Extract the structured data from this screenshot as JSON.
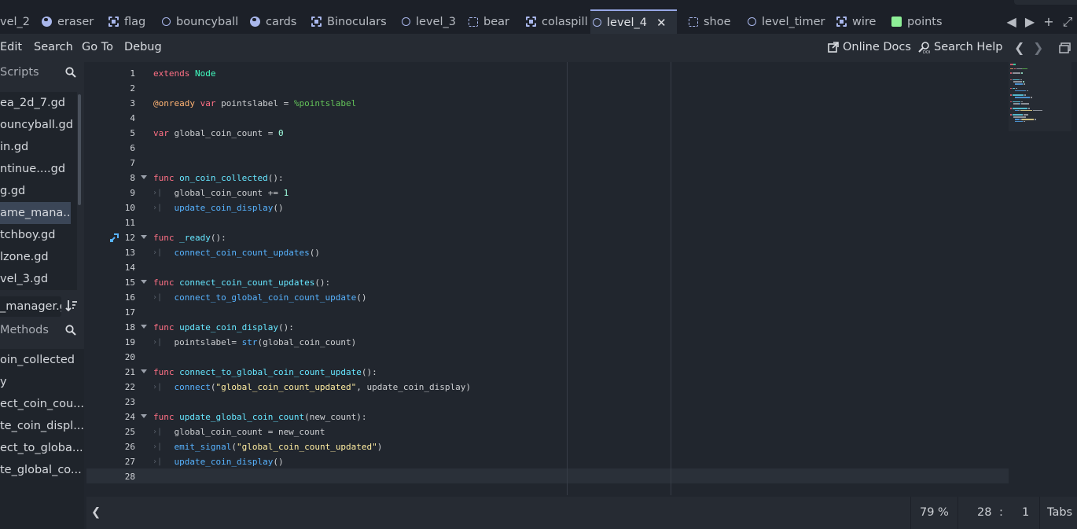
{
  "tabs": [
    {
      "label": "vel_2",
      "icon": "scene-icon"
    },
    {
      "label": "eraser",
      "icon": "globe-icon"
    },
    {
      "label": "flag",
      "icon": "frame-icon"
    },
    {
      "label": "bouncyball",
      "icon": "scene-icon"
    },
    {
      "label": "cards",
      "icon": "globe-icon"
    },
    {
      "label": "Binoculars",
      "icon": "frame-icon"
    },
    {
      "label": "level_3",
      "icon": "scene-icon"
    },
    {
      "label": "bear",
      "icon": "rect-icon"
    },
    {
      "label": "colaspill",
      "icon": "frame-icon"
    },
    {
      "label": "level_4",
      "icon": "scene-icon",
      "active": true,
      "close": "✕"
    },
    {
      "label": "shoe",
      "icon": "rect-icon"
    },
    {
      "label": "level_timer",
      "icon": "scene-icon"
    },
    {
      "label": "wire",
      "icon": "frame-icon"
    },
    {
      "label": "points",
      "icon": "green-icon"
    }
  ],
  "tab_tools": {
    "prev": "◀",
    "next": "▶",
    "add": "+",
    "distraction": "⤢"
  },
  "menu": {
    "edit": "Edit",
    "search": "Search",
    "goto": "Go To",
    "debug": "Debug",
    "online_docs": "Online Docs",
    "search_help": "Search Help",
    "back": "❮",
    "forward": "❯"
  },
  "scripts_panel": {
    "title": "Scripts",
    "items": [
      "ea_2d_7.gd",
      "ouncyball.gd",
      "in.gd",
      "ntinue....gd",
      "g.gd",
      "ame_mana...",
      "tchboy.gd",
      "lzone.gd",
      "vel_3.gd"
    ],
    "selected_index": 5,
    "filter_value": "_manager.g"
  },
  "methods_panel": {
    "title": "Methods",
    "items": [
      "oin_collected",
      "y",
      "ect_coin_cou...",
      "te_coin_displ...",
      "ect_to_globa...",
      "te_global_co..."
    ]
  },
  "code_lines": [
    {
      "n": "1",
      "tokens": [
        [
          "kw",
          "extends "
        ],
        [
          "ty",
          "Node"
        ]
      ]
    },
    {
      "n": "2",
      "tokens": []
    },
    {
      "n": "3",
      "tokens": [
        [
          "an",
          "@onready "
        ],
        [
          "kw",
          "var "
        ],
        [
          "tx",
          "pointslabel = "
        ],
        [
          "np",
          "%pointslabel"
        ]
      ]
    },
    {
      "n": "4",
      "tokens": []
    },
    {
      "n": "5",
      "tokens": [
        [
          "kw",
          "var "
        ],
        [
          "tx",
          "global_coin_count = "
        ],
        [
          "nm",
          "0"
        ]
      ]
    },
    {
      "n": "6",
      "tokens": []
    },
    {
      "n": "7",
      "tokens": []
    },
    {
      "n": "8",
      "fold": true,
      "tokens": [
        [
          "kw",
          "func "
        ],
        [
          "dfn",
          "on_coin_collected"
        ],
        [
          "tx",
          "():"
        ]
      ]
    },
    {
      "n": "9",
      "tab": true,
      "tokens": [
        [
          "tx",
          "    global_coin_count += "
        ],
        [
          "nm",
          "1"
        ]
      ]
    },
    {
      "n": "10",
      "tab": true,
      "tokens": [
        [
          "tx",
          "    "
        ],
        [
          "fn",
          "update_coin_display"
        ],
        [
          "tx",
          "()"
        ]
      ]
    },
    {
      "n": "11",
      "tokens": []
    },
    {
      "n": "12",
      "fold": true,
      "icon": true,
      "tokens": [
        [
          "kw",
          "func "
        ],
        [
          "dfn",
          "_ready"
        ],
        [
          "tx",
          "():"
        ]
      ]
    },
    {
      "n": "13",
      "tab": true,
      "tokens": [
        [
          "tx",
          "    "
        ],
        [
          "fn",
          "connect_coin_count_updates"
        ],
        [
          "tx",
          "()"
        ]
      ]
    },
    {
      "n": "14",
      "tokens": []
    },
    {
      "n": "15",
      "fold": true,
      "tokens": [
        [
          "kw",
          "func "
        ],
        [
          "dfn",
          "connect_coin_count_updates"
        ],
        [
          "tx",
          "():"
        ]
      ]
    },
    {
      "n": "16",
      "tab": true,
      "tokens": [
        [
          "tx",
          "    "
        ],
        [
          "fn",
          "connect_to_global_coin_count_update"
        ],
        [
          "tx",
          "()"
        ]
      ]
    },
    {
      "n": "17",
      "tokens": []
    },
    {
      "n": "18",
      "fold": true,
      "tokens": [
        [
          "kw",
          "func "
        ],
        [
          "dfn",
          "update_coin_display"
        ],
        [
          "tx",
          "():"
        ]
      ]
    },
    {
      "n": "19",
      "tab": true,
      "tokens": [
        [
          "tx",
          "    pointslabel= "
        ],
        [
          "fn",
          "str"
        ],
        [
          "tx",
          "(global_coin_count)"
        ]
      ]
    },
    {
      "n": "20",
      "tokens": []
    },
    {
      "n": "21",
      "fold": true,
      "tokens": [
        [
          "kw",
          "func "
        ],
        [
          "dfn",
          "connect_to_global_coin_count_update"
        ],
        [
          "tx",
          "():"
        ]
      ]
    },
    {
      "n": "22",
      "tab": true,
      "tokens": [
        [
          "tx",
          "    "
        ],
        [
          "fn",
          "connect"
        ],
        [
          "tx",
          "("
        ],
        [
          "str",
          "\"global_coin_count_updated\""
        ],
        [
          "tx",
          ", update_coin_display)"
        ]
      ]
    },
    {
      "n": "23",
      "tokens": []
    },
    {
      "n": "24",
      "fold": true,
      "tokens": [
        [
          "kw",
          "func "
        ],
        [
          "dfn",
          "update_global_coin_count"
        ],
        [
          "tx",
          "(new_count):"
        ]
      ]
    },
    {
      "n": "25",
      "tab": true,
      "tokens": [
        [
          "tx",
          "    global_coin_count = new_count"
        ]
      ]
    },
    {
      "n": "26",
      "tab": true,
      "tokens": [
        [
          "tx",
          "    "
        ],
        [
          "fn",
          "emit_signal"
        ],
        [
          "tx",
          "("
        ],
        [
          "str",
          "\"global_coin_count_updated\""
        ],
        [
          "tx",
          ")"
        ]
      ]
    },
    {
      "n": "27",
      "tab": true,
      "tokens": [
        [
          "tx",
          "    "
        ],
        [
          "fn",
          "update_coin_display"
        ],
        [
          "tx",
          "()"
        ]
      ]
    },
    {
      "n": "28",
      "tokens": []
    }
  ],
  "statusbar": {
    "toggle": "❮",
    "zoom": "79 %",
    "line": "28",
    "colon": ":",
    "col": "1",
    "indent": "Tabs"
  },
  "colors": {
    "accent": "#97a8e6",
    "keyword": "#ff7085",
    "type": "#42ffc2",
    "function": "#57b3ff",
    "string": "#ffeda1",
    "number": "#a1ffe0",
    "annotation": "#ffb373",
    "nodepath": "#63c259"
  }
}
